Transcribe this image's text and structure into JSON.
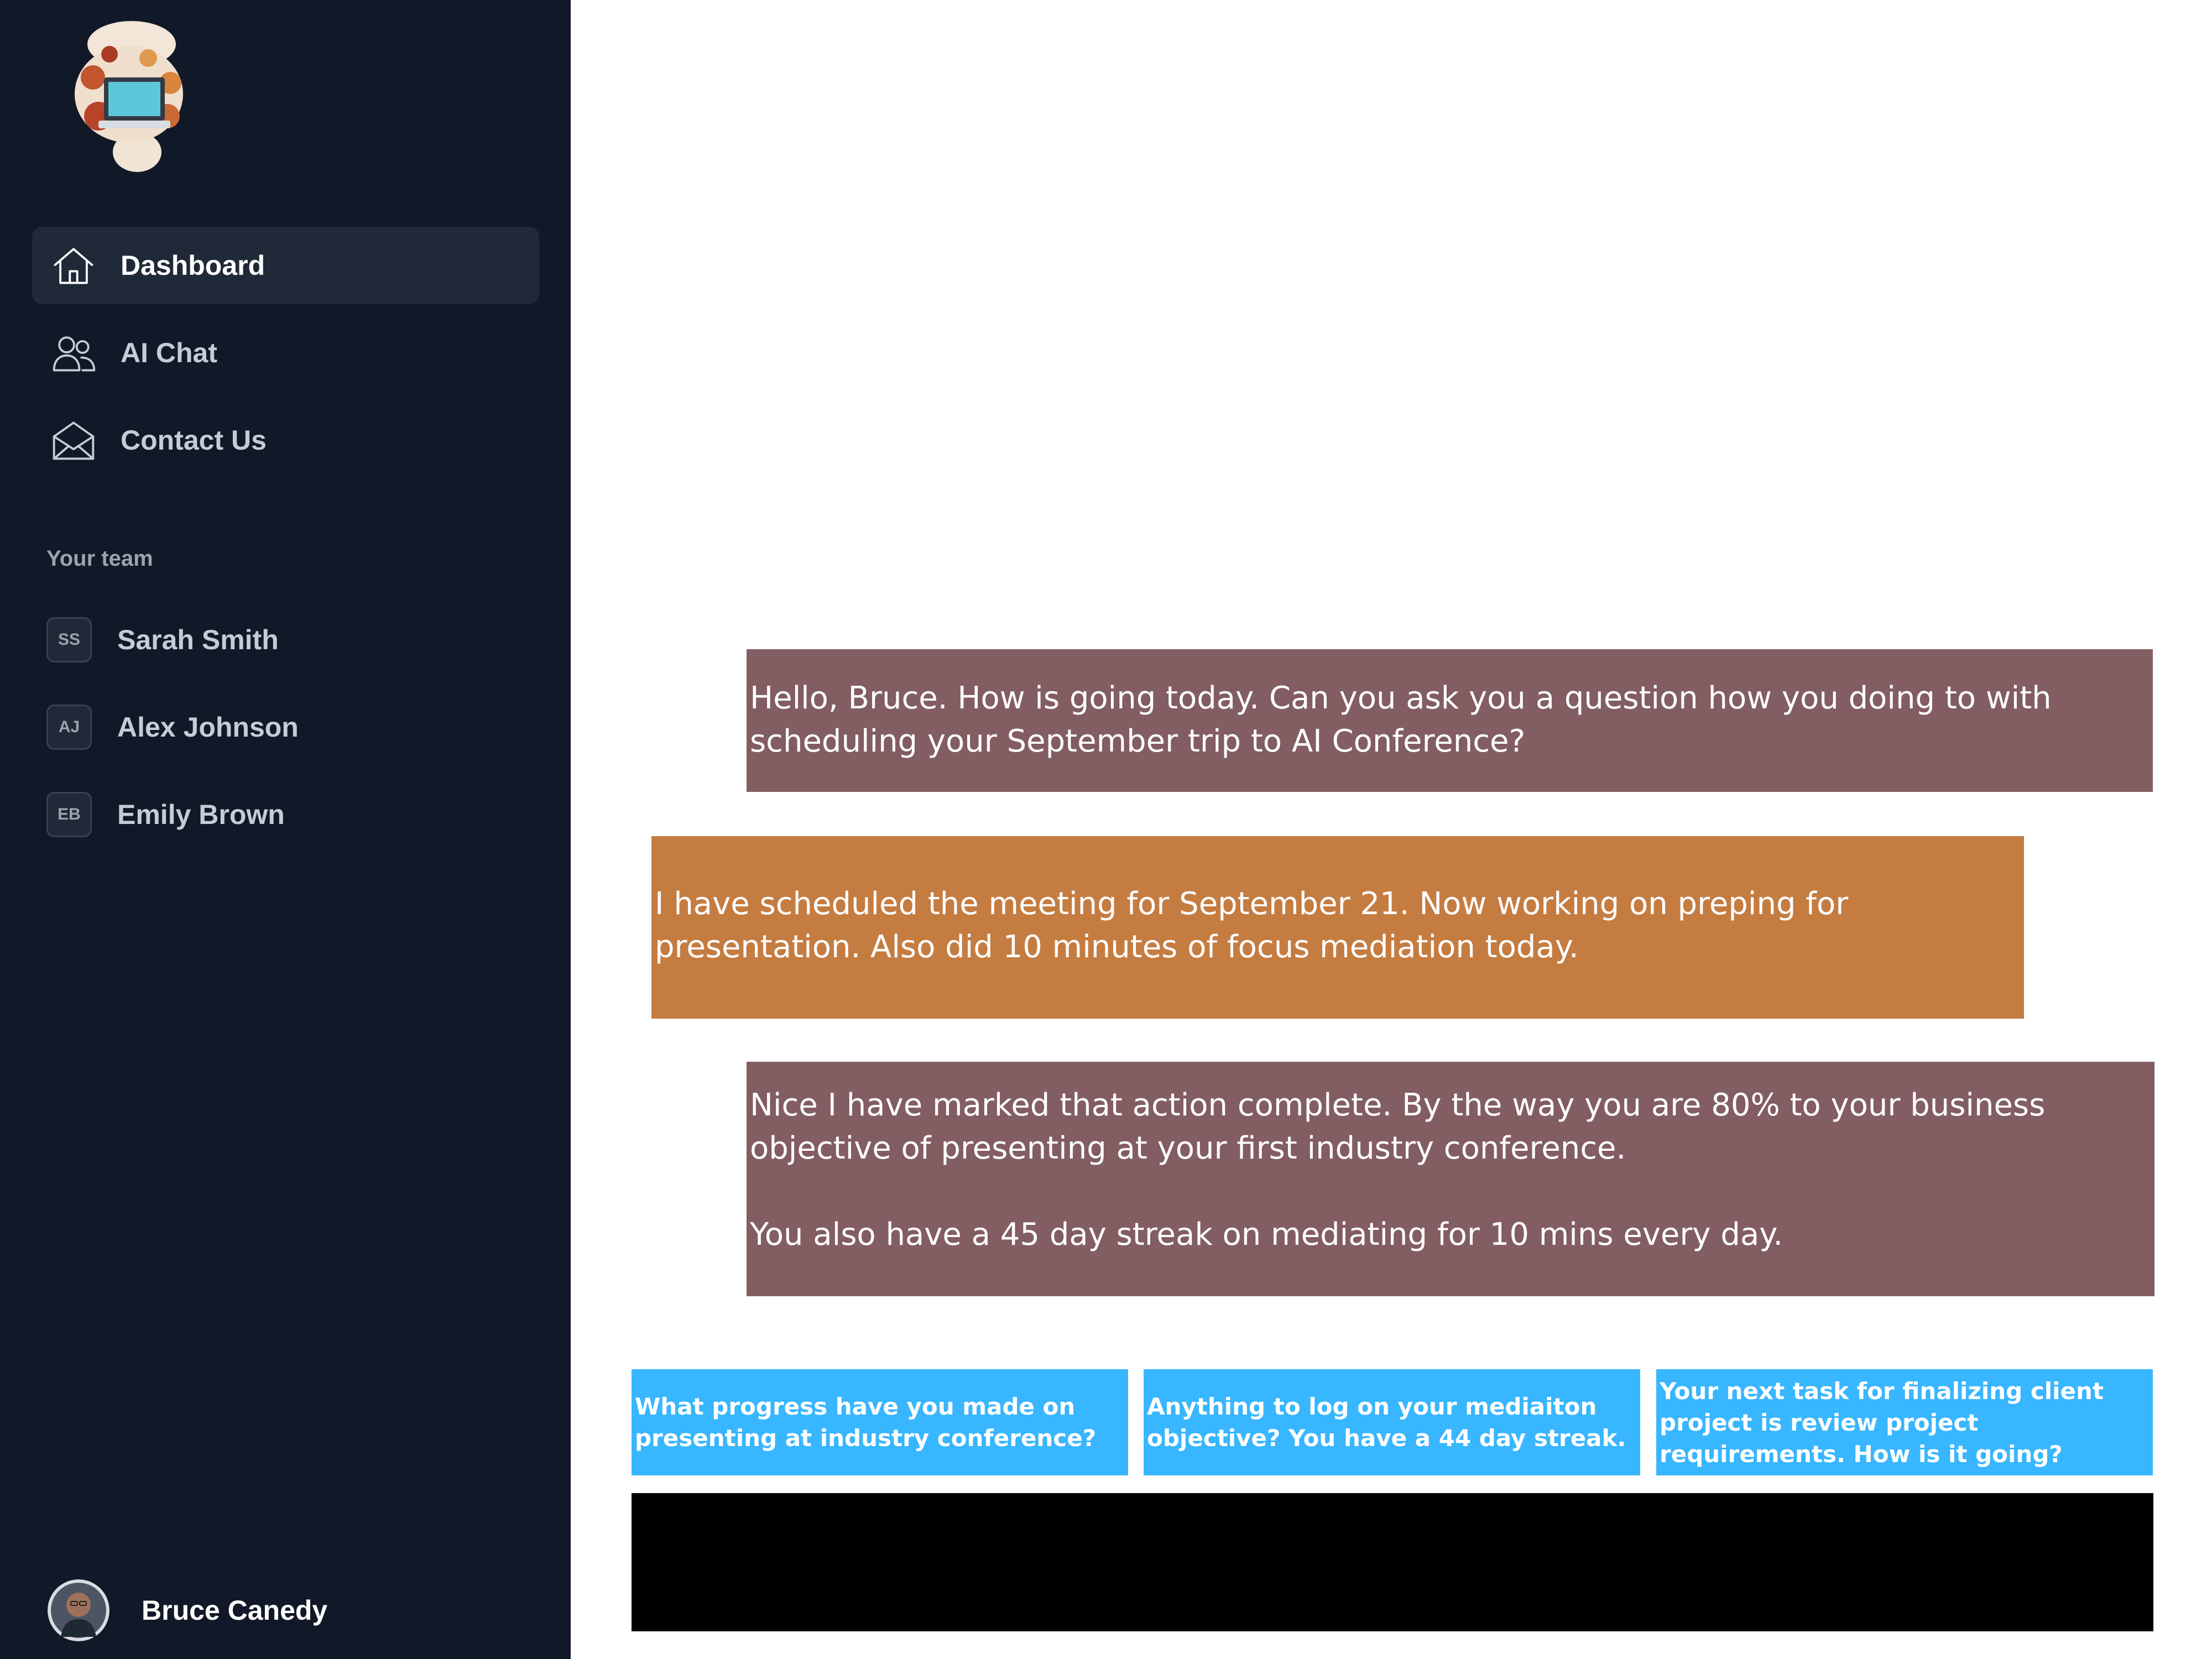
{
  "sidebar": {
    "nav": [
      {
        "label": "Dashboard",
        "icon": "home-icon",
        "active": true
      },
      {
        "label": "AI Chat",
        "icon": "users-icon",
        "active": false
      },
      {
        "label": "Contact Us",
        "icon": "envelope-open-icon",
        "active": false
      }
    ],
    "team_heading": "Your team",
    "team": [
      {
        "initials": "SS",
        "name": "Sarah Smith"
      },
      {
        "initials": "AJ",
        "name": "Alex Johnson"
      },
      {
        "initials": "EB",
        "name": "Emily Brown"
      }
    ],
    "user": {
      "name": "Bruce Canedy"
    }
  },
  "chat": {
    "messages": [
      {
        "role": "assistant",
        "text": "Hello, Bruce. How is going today. Can you ask you a question how you doing to with scheduling your September trip to AI Conference?"
      },
      {
        "role": "user",
        "text": "I have scheduled the meeting for September 21. Now working on preping for presentation. Also did 10 minutes of focus mediation today."
      },
      {
        "role": "assistant",
        "text": "Nice I have marked that action complete. By the way you are 80% to your business objective of presenting at your first industry conference.\n\nYou also have a 45 day streak on mediating for 10 mins every day."
      }
    ],
    "suggestions": [
      "What progress have you made on presenting at industry conference?",
      "Anything to log on your mediaiton objective? You have a 44 day streak.",
      "Your next task for finalizing client project is review project requirements. How is it going?"
    ]
  },
  "colors": {
    "sidebar_bg": "#111827",
    "assistant_bubble": "#825d62",
    "user_bubble": "#c57c41",
    "suggestion": "#38b6ff",
    "input_area": "#000000"
  }
}
